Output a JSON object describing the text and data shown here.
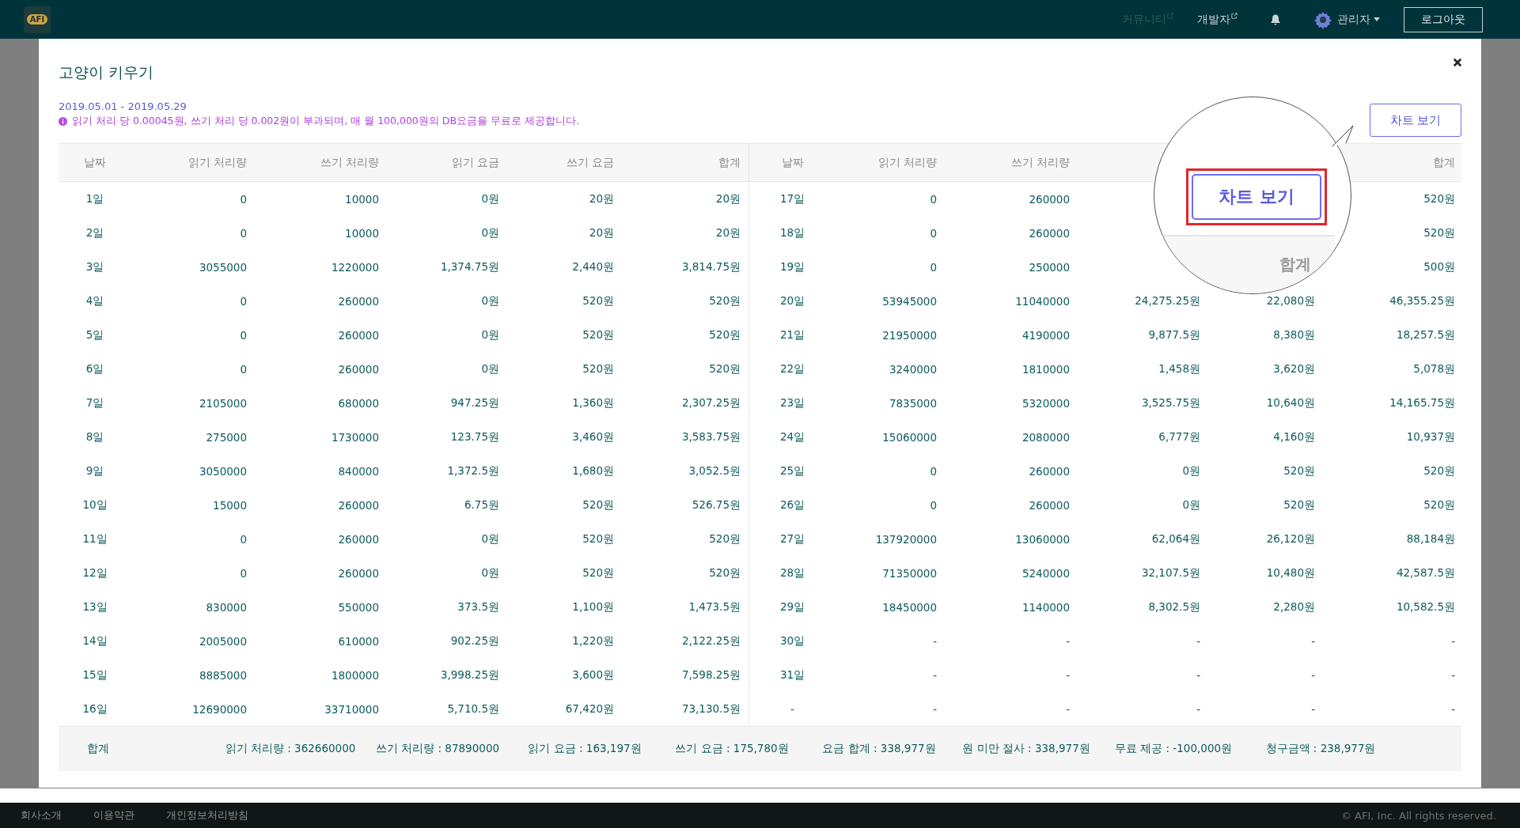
{
  "top_bar": {
    "logo": "AFI",
    "nav": [
      {
        "label": "커뮤니티",
        "faded": true
      },
      {
        "label": "개발자",
        "faded": false
      }
    ],
    "user": "관리자",
    "logout": "로그아웃"
  },
  "modal": {
    "title": "고양이 키우기",
    "period": "2019.05.01 - 2019.05.29",
    "notice": "읽기 처리 당 0.00045원, 쓰기 처리 당 0.002원이 부과되며, 매 월 100,000원의 DB요금을 무료로 제공합니다.",
    "chart_button": "차트 보기",
    "table": {
      "columns": [
        "날짜",
        "읽기 처리량",
        "쓰기 처리량",
        "읽기 요금",
        "쓰기 요금",
        "합계",
        "날짜",
        "읽기 처리량",
        "쓰기 처리량",
        null,
        null,
        "합계"
      ],
      "rows": [
        [
          "1일",
          "0",
          "10000",
          "0원",
          "20원",
          "20원",
          "17일",
          "0",
          "260000",
          null,
          null,
          "520원"
        ],
        [
          "2일",
          "0",
          "10000",
          "0원",
          "20원",
          "20원",
          "18일",
          "0",
          "260000",
          null,
          null,
          "520원"
        ],
        [
          "3일",
          "3055000",
          "1220000",
          "1,374.75원",
          "2,440원",
          "3,814.75원",
          "19일",
          "0",
          "250000",
          null,
          null,
          "500원"
        ],
        [
          "4일",
          "0",
          "260000",
          "0원",
          "520원",
          "520원",
          "20일",
          "53945000",
          "11040000",
          "24,275.25원",
          "22,080원",
          "46,355.25원"
        ],
        [
          "5일",
          "0",
          "260000",
          "0원",
          "520원",
          "520원",
          "21일",
          "21950000",
          "4190000",
          "9,877.5원",
          "8,380원",
          "18,257.5원"
        ],
        [
          "6일",
          "0",
          "260000",
          "0원",
          "520원",
          "520원",
          "22일",
          "3240000",
          "1810000",
          "1,458원",
          "3,620원",
          "5,078원"
        ],
        [
          "7일",
          "2105000",
          "680000",
          "947.25원",
          "1,360원",
          "2,307.25원",
          "23일",
          "7835000",
          "5320000",
          "3,525.75원",
          "10,640원",
          "14,165.75원"
        ],
        [
          "8일",
          "275000",
          "1730000",
          "123.75원",
          "3,460원",
          "3,583.75원",
          "24일",
          "15060000",
          "2080000",
          "6,777원",
          "4,160원",
          "10,937원"
        ],
        [
          "9일",
          "3050000",
          "840000",
          "1,372.5원",
          "1,680원",
          "3,052.5원",
          "25일",
          "0",
          "260000",
          "0원",
          "520원",
          "520원"
        ],
        [
          "10일",
          "15000",
          "260000",
          "6.75원",
          "520원",
          "526.75원",
          "26일",
          "0",
          "260000",
          "0원",
          "520원",
          "520원"
        ],
        [
          "11일",
          "0",
          "260000",
          "0원",
          "520원",
          "520원",
          "27일",
          "137920000",
          "13060000",
          "62,064원",
          "26,120원",
          "88,184원"
        ],
        [
          "12일",
          "0",
          "260000",
          "0원",
          "520원",
          "520원",
          "28일",
          "71350000",
          "5240000",
          "32,107.5원",
          "10,480원",
          "42,587.5원"
        ],
        [
          "13일",
          "830000",
          "550000",
          "373.5원",
          "1,100원",
          "1,473.5원",
          "29일",
          "18450000",
          "1140000",
          "8,302.5원",
          "2,280원",
          "10,582.5원"
        ],
        [
          "14일",
          "2005000",
          "610000",
          "902.25원",
          "1,220원",
          "2,122.25원",
          "30일",
          "-",
          "-",
          "-",
          "-",
          "-"
        ],
        [
          "15일",
          "8885000",
          "1800000",
          "3,998.25원",
          "3,600원",
          "7,598.25원",
          "31일",
          "-",
          "-",
          "-",
          "-",
          "-"
        ],
        [
          "16일",
          "12690000",
          "33710000",
          "5,710.5원",
          "67,420원",
          "73,130.5원",
          "-",
          "-",
          "-",
          "-",
          "-",
          "-"
        ]
      ],
      "summary": [
        "합계",
        "읽기 처리량 : 362660000",
        "쓰기 처리량 : 87890000",
        "읽기 요금 : 163,197원",
        "쓰기 요금 : 175,780원",
        "요금 합계 : 338,977원",
        "원 미만 절사 : 338,977원",
        "무료 제공 : -100,000원",
        "청구금액 : 238,977원"
      ]
    },
    "magnifier": {
      "button": "차트 보기",
      "column_label": "합계"
    }
  },
  "footer": {
    "links": [
      "회사소개",
      "이용약관",
      "개인정보처리방침"
    ],
    "copyright": "© AFI, Inc. All rights reserved."
  }
}
